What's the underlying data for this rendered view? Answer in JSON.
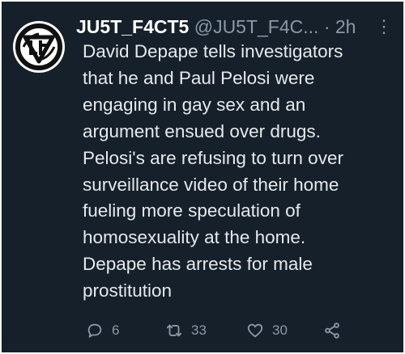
{
  "tweet": {
    "display_name": "JU5T_F4CT5",
    "handle": "@JU5T_F4C...",
    "separator": "·",
    "time": "2h",
    "more_label": "⋮",
    "text": "David Depape tells investigators\nthat he and Paul Pelosi were\nengaging in gay sex and an\nargument ensued over drugs.\nPelosi's are refusing to turn over\nsurveillance video of their home\nfueling more speculation of\nhomosexuality at the home.\nDepape has arrests for male\nprostitution"
  },
  "actions": {
    "replies": "6",
    "retweets": "33",
    "likes": "30"
  },
  "icons": {
    "avatar": "ju5t-f4ct5-logo",
    "reply": "speech-bubble-icon",
    "retweet": "retweet-arrows-icon",
    "like": "heart-icon",
    "share": "share-nodes-icon"
  },
  "colors": {
    "background": "#15202b",
    "text": "#e7e9ea",
    "muted": "#8b98a5",
    "name": "#ffffff"
  }
}
